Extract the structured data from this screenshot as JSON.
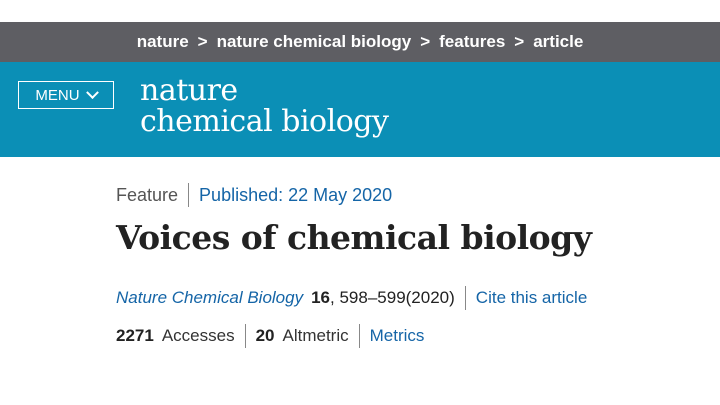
{
  "breadcrumb": {
    "items": [
      "nature",
      "nature chemical biology",
      "features",
      "article"
    ],
    "separator": ">"
  },
  "header": {
    "menu_label": "MENU",
    "logo_line1": "nature",
    "logo_line2": "chemical biology",
    "bg_color": "#0b8fb6"
  },
  "article": {
    "type": "Feature",
    "published": "Published: 22 May 2020",
    "title": "Voices of chemical biology",
    "journal": "Nature Chemical Biology",
    "volume": "16",
    "pages": ", 598–599(2020)",
    "cite_label": "Cite this article",
    "accesses_count": "2271",
    "accesses_label": "Accesses",
    "altmetric_count": "20",
    "altmetric_label": "Altmetric",
    "metrics_label": "Metrics"
  },
  "colors": {
    "topbar": "#5e5e63",
    "link": "#1565a7"
  }
}
